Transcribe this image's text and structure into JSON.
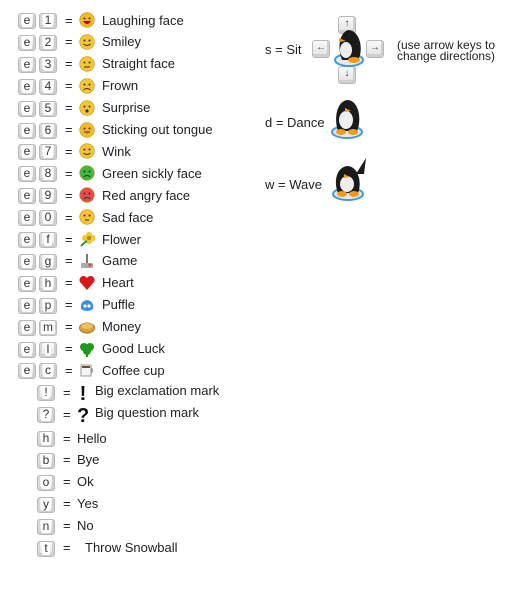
{
  "emote_rows": [
    {
      "keys": [
        "e",
        "1"
      ],
      "icon": "laughing-face-icon",
      "label": "Laughing face",
      "color": "#f5b829"
    },
    {
      "keys": [
        "e",
        "2"
      ],
      "icon": "smiley-icon",
      "label": "Smiley",
      "color": "#f5c534"
    },
    {
      "keys": [
        "e",
        "3"
      ],
      "icon": "straight-face-icon",
      "label": "Straight face",
      "color": "#f5c534"
    },
    {
      "keys": [
        "e",
        "4"
      ],
      "icon": "frown-icon",
      "label": "Frown",
      "color": "#f5c534"
    },
    {
      "keys": [
        "e",
        "5"
      ],
      "icon": "surprise-icon",
      "label": "Surprise",
      "color": "#f5c534"
    },
    {
      "keys": [
        "e",
        "6"
      ],
      "icon": "tongue-icon",
      "label": "Sticking out tongue",
      "color": "#f5b829"
    },
    {
      "keys": [
        "e",
        "7"
      ],
      "icon": "wink-icon",
      "label": "Wink",
      "color": "#f5c534"
    },
    {
      "keys": [
        "e",
        "8"
      ],
      "icon": "sick-face-icon",
      "label": "Green sickly face",
      "color": "#3dbb3d"
    },
    {
      "keys": [
        "e",
        "9"
      ],
      "icon": "angry-face-icon",
      "label": "Red angry face",
      "color": "#e84b4b"
    },
    {
      "keys": [
        "e",
        "0"
      ],
      "icon": "sad-face-icon",
      "label": "Sad face",
      "color": "#f5c534"
    },
    {
      "keys": [
        "e",
        "f"
      ],
      "icon": "flower-icon",
      "label": "Flower",
      "color": "#f5c534"
    },
    {
      "keys": [
        "e",
        "g"
      ],
      "icon": "game-icon",
      "label": "Game",
      "color": "#888888"
    },
    {
      "keys": [
        "e",
        "h"
      ],
      "icon": "heart-icon",
      "label": "Heart",
      "color": "#e01515"
    },
    {
      "keys": [
        "e",
        "p"
      ],
      "icon": "puffle-icon",
      "label": "Puffle",
      "color": "#3a8fe0"
    },
    {
      "keys": [
        "e",
        "m"
      ],
      "icon": "money-icon",
      "label": "Money",
      "color": "#d9a23a"
    },
    {
      "keys": [
        "e",
        "l"
      ],
      "icon": "clover-icon",
      "label": "Good Luck",
      "color": "#1f9a1f"
    },
    {
      "keys": [
        "e",
        "c"
      ],
      "icon": "coffee-cup-icon",
      "label": "Coffee cup",
      "color": "#d0d0d0"
    }
  ],
  "symbol_rows": [
    {
      "key": "!",
      "glyph": "!",
      "icon": "exclamation-icon",
      "label": "Big exclamation mark"
    },
    {
      "key": "?",
      "glyph": "?",
      "icon": "question-icon",
      "label": "Big question mark"
    }
  ],
  "word_rows": [
    {
      "key": "h",
      "label": "Hello"
    },
    {
      "key": "b",
      "label": "Bye"
    },
    {
      "key": "o",
      "label": "Ok"
    },
    {
      "key": "y",
      "label": "Yes"
    },
    {
      "key": "n",
      "label": "No"
    },
    {
      "key": "t",
      "label": "Throw Snowball"
    }
  ],
  "actions": {
    "sit": {
      "label": "s = Sit",
      "arrows": {
        "up": "↑",
        "down": "↓",
        "left": "←",
        "right": "→"
      }
    },
    "sit_note_line1": "(use arrow keys to",
    "sit_note_line2": "change directions)",
    "dance": {
      "label": "d = Dance"
    },
    "wave": {
      "label": "w = Wave"
    }
  },
  "equals": "="
}
